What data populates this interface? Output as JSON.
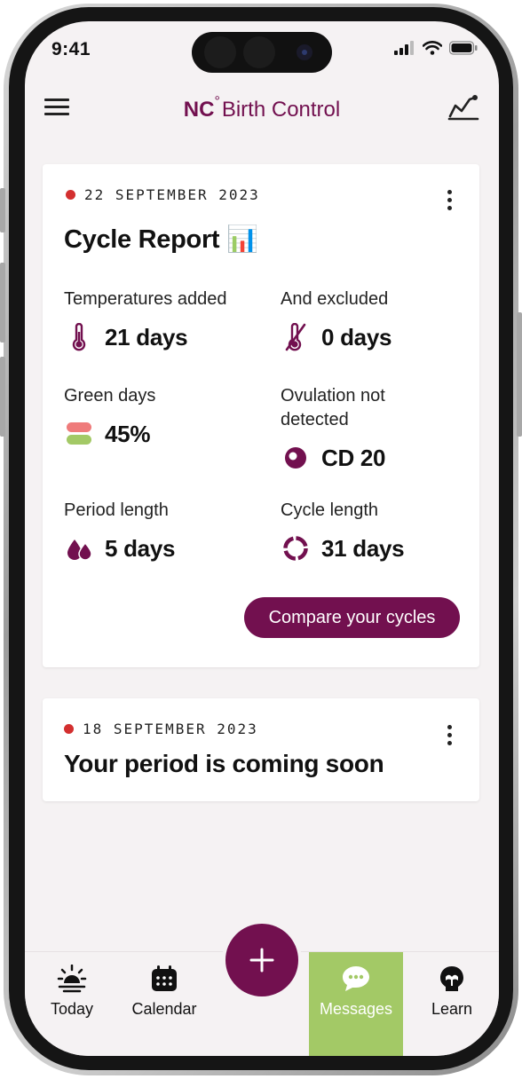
{
  "status_bar": {
    "time": "9:41",
    "icons": [
      "cellular-signal-icon",
      "wifi-icon",
      "battery-icon"
    ]
  },
  "header": {
    "brand_prefix": "NC",
    "brand_degree": "°",
    "brand_name": "Birth Control",
    "menu_icon": "hamburger-menu-icon",
    "graph_icon": "temperature-graph-icon"
  },
  "colors": {
    "brand": "#72104f",
    "screen_bg": "#f5f2f3",
    "alert_dot": "#d32f2f",
    "active_tab": "#a3c966",
    "red_day": "#ef7b7b",
    "green_day": "#a3c966"
  },
  "cards": [
    {
      "date": "22 SEPTEMBER 2023",
      "title": "Cycle Report 📊",
      "stats": [
        {
          "label": "Temperatures added",
          "value": "21 days",
          "icon": "thermometer-icon"
        },
        {
          "label": "And excluded",
          "value": "0 days",
          "icon": "excluded-thermometer-icon"
        },
        {
          "label": "Green days",
          "value": "45%",
          "icon": "green-days-icon"
        },
        {
          "label": "Ovulation not detected",
          "value": "CD 20",
          "icon": "ovulation-icon"
        },
        {
          "label": "Period length",
          "value": "5 days",
          "icon": "period-drops-icon"
        },
        {
          "label": "Cycle length",
          "value": "31 days",
          "icon": "cycle-ring-icon"
        }
      ],
      "button": "Compare your cycles"
    },
    {
      "date": "18 SEPTEMBER 2023",
      "title": "Your period is coming soon"
    }
  ],
  "tabs": [
    {
      "label": "Today",
      "icon": "sunrise-icon",
      "active": false
    },
    {
      "label": "Calendar",
      "icon": "calendar-icon",
      "active": false
    },
    {
      "label": "Messages",
      "icon": "chat-bubble-icon",
      "active": true
    },
    {
      "label": "Learn",
      "icon": "learn-icon",
      "active": false
    }
  ],
  "fab": {
    "icon": "plus-icon"
  }
}
